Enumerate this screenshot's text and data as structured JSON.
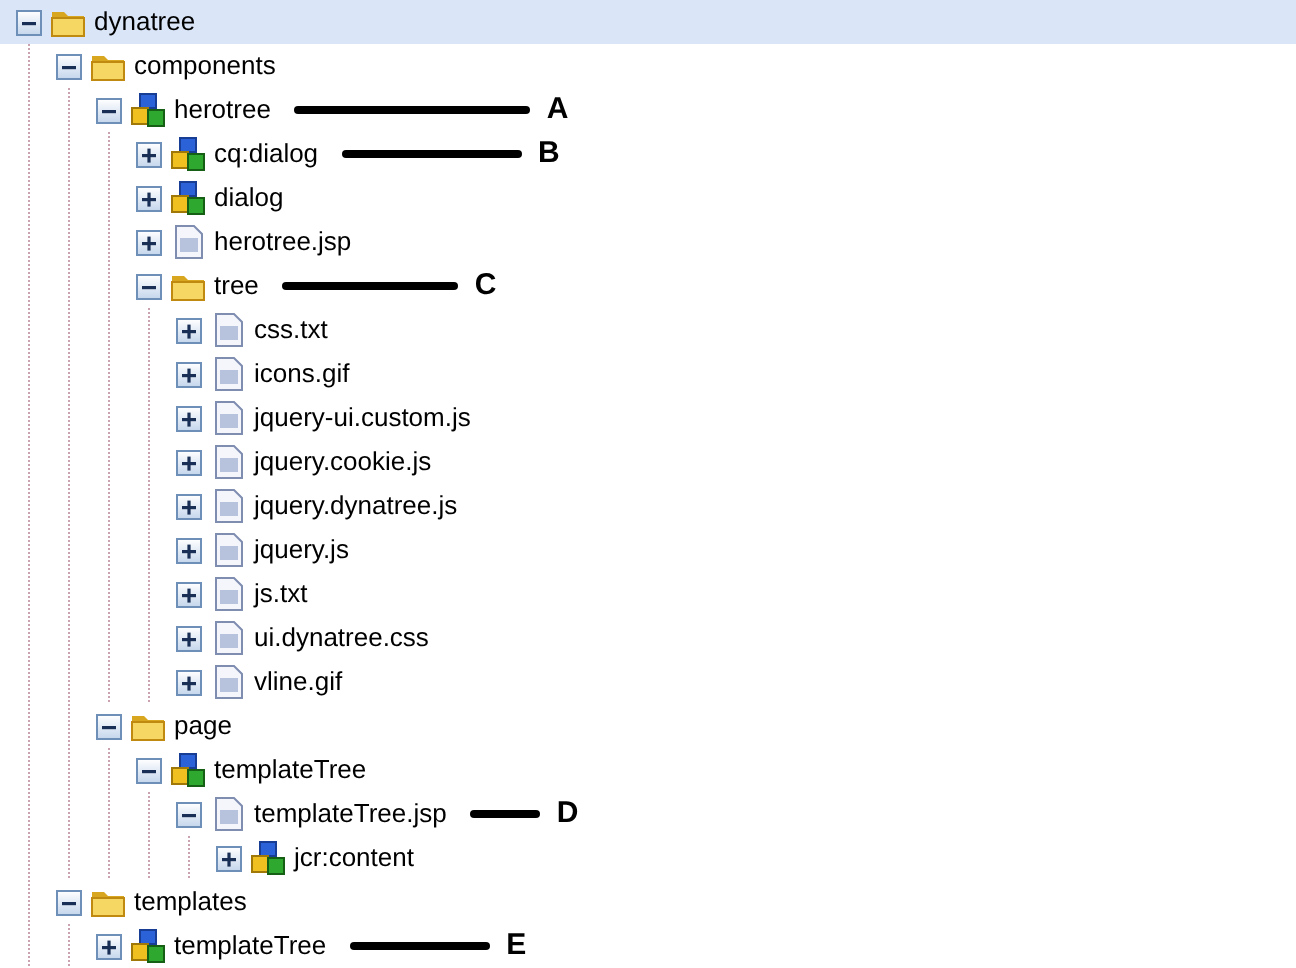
{
  "tree": [
    {
      "kind": "folder",
      "label": "dynatree",
      "expanded": true,
      "selected": true,
      "children": [
        {
          "kind": "folder",
          "label": "components",
          "expanded": true,
          "selected": false,
          "children": [
            {
              "kind": "component",
              "label": "herotree",
              "expanded": true,
              "selected": false,
              "annotation": "A",
              "children": [
                {
                  "kind": "component",
                  "label": "cq:dialog",
                  "expanded": false,
                  "selected": false,
                  "annotation": "B"
                },
                {
                  "kind": "component",
                  "label": "dialog",
                  "expanded": false,
                  "selected": false
                },
                {
                  "kind": "file",
                  "label": "herotree.jsp",
                  "expanded": false,
                  "selected": false
                },
                {
                  "kind": "folder",
                  "label": "tree",
                  "expanded": true,
                  "selected": false,
                  "annotation": "C",
                  "children": [
                    {
                      "kind": "file",
                      "label": "css.txt",
                      "expanded": false,
                      "selected": false
                    },
                    {
                      "kind": "file",
                      "label": "icons.gif",
                      "expanded": false,
                      "selected": false
                    },
                    {
                      "kind": "file",
                      "label": "jquery-ui.custom.js",
                      "expanded": false,
                      "selected": false
                    },
                    {
                      "kind": "file",
                      "label": "jquery.cookie.js",
                      "expanded": false,
                      "selected": false
                    },
                    {
                      "kind": "file",
                      "label": "jquery.dynatree.js",
                      "expanded": false,
                      "selected": false
                    },
                    {
                      "kind": "file",
                      "label": "jquery.js",
                      "expanded": false,
                      "selected": false
                    },
                    {
                      "kind": "file",
                      "label": "js.txt",
                      "expanded": false,
                      "selected": false
                    },
                    {
                      "kind": "file",
                      "label": "ui.dynatree.css",
                      "expanded": false,
                      "selected": false
                    },
                    {
                      "kind": "file",
                      "label": "vline.gif",
                      "expanded": false,
                      "selected": false
                    }
                  ]
                }
              ]
            },
            {
              "kind": "folder",
              "label": "page",
              "expanded": true,
              "selected": false,
              "children": [
                {
                  "kind": "component",
                  "label": "templateTree",
                  "expanded": true,
                  "selected": false,
                  "children": [
                    {
                      "kind": "file",
                      "label": "templateTree.jsp",
                      "expanded": true,
                      "selected": false,
                      "annotation": "D",
                      "children": [
                        {
                          "kind": "component",
                          "label": "jcr:content",
                          "expanded": false,
                          "selected": false
                        }
                      ]
                    }
                  ]
                }
              ]
            }
          ]
        },
        {
          "kind": "folder",
          "label": "templates",
          "expanded": true,
          "selected": false,
          "children": [
            {
              "kind": "component",
              "label": "templateTree",
              "expanded": false,
              "selected": false,
              "annotation": "E"
            }
          ]
        }
      ]
    }
  ]
}
